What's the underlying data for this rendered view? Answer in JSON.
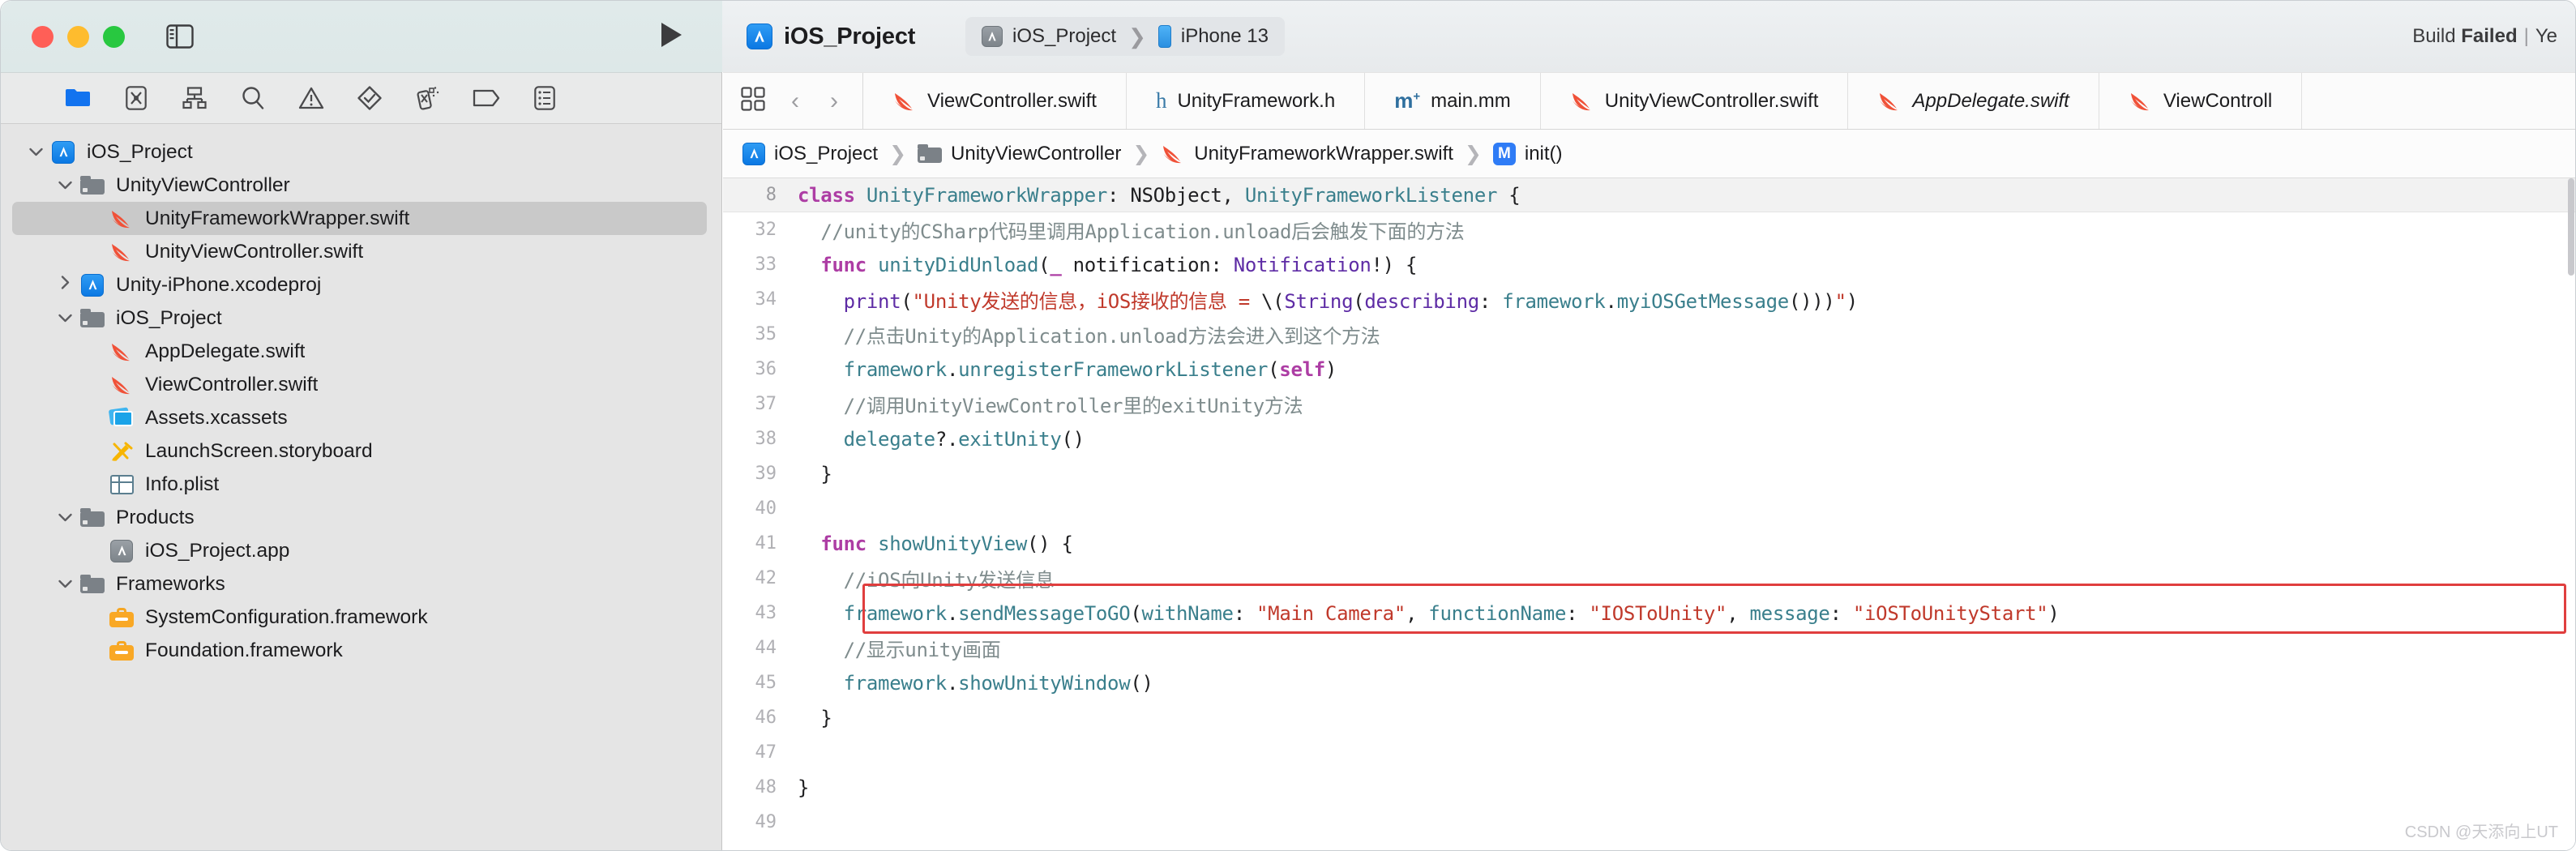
{
  "window": {
    "traffic_lights": [
      "close",
      "minimize",
      "zoom"
    ],
    "sidebar_toggle_icon": "sidebar-toggle-icon",
    "run_button_icon": "run-play-icon"
  },
  "toolbar": {
    "project_name": "iOS_Project",
    "scheme": "iOS_Project",
    "destination": "iPhone 13",
    "build_status_prefix": "Build ",
    "build_status_result": "Failed",
    "build_status_separator": "|",
    "build_status_suffix": "Ye",
    "accent_blue": "#0b78e3",
    "fail_color": "#3b3b3d"
  },
  "navigator": {
    "toolbar_icons": [
      {
        "name": "project-navigator-icon",
        "glyph": "folder",
        "active": true
      },
      {
        "name": "source-control-navigator-icon",
        "glyph": "x-box"
      },
      {
        "name": "symbol-navigator-icon",
        "glyph": "hierarchy"
      },
      {
        "name": "find-navigator-icon",
        "glyph": "magnifier"
      },
      {
        "name": "issue-navigator-icon",
        "glyph": "warning-triangle"
      },
      {
        "name": "test-navigator-icon",
        "glyph": "diamond-check"
      },
      {
        "name": "debug-navigator-icon",
        "glyph": "spray"
      },
      {
        "name": "breakpoint-navigator-icon",
        "glyph": "tag"
      },
      {
        "name": "report-navigator-icon",
        "glyph": "report-list"
      }
    ],
    "tree": [
      {
        "label": "iOS_Project",
        "icon": "app-icon",
        "depth": 0,
        "disclosure": "down",
        "selected": false
      },
      {
        "label": "UnityViewController",
        "icon": "folder-icon",
        "depth": 1,
        "disclosure": "down",
        "selected": false
      },
      {
        "label": "UnityFrameworkWrapper.swift",
        "icon": "swift-icon",
        "depth": 2,
        "disclosure": "none",
        "selected": true
      },
      {
        "label": "UnityViewController.swift",
        "icon": "swift-icon",
        "depth": 2,
        "disclosure": "none",
        "selected": false
      },
      {
        "label": "Unity-iPhone.xcodeproj",
        "icon": "app-icon",
        "depth": 1,
        "disclosure": "right",
        "selected": false
      },
      {
        "label": "iOS_Project",
        "icon": "folder-icon",
        "depth": 1,
        "disclosure": "down",
        "selected": false
      },
      {
        "label": "AppDelegate.swift",
        "icon": "swift-icon",
        "depth": 2,
        "disclosure": "none",
        "selected": false
      },
      {
        "label": "ViewController.swift",
        "icon": "swift-icon",
        "depth": 2,
        "disclosure": "none",
        "selected": false
      },
      {
        "label": "Assets.xcassets",
        "icon": "xcassets-icon",
        "depth": 2,
        "disclosure": "none",
        "selected": false
      },
      {
        "label": "LaunchScreen.storyboard",
        "icon": "storyboard-icon",
        "depth": 2,
        "disclosure": "none",
        "selected": false
      },
      {
        "label": "Info.plist",
        "icon": "plist-icon",
        "depth": 2,
        "disclosure": "none",
        "selected": false
      },
      {
        "label": "Products",
        "icon": "folder-icon",
        "depth": 1,
        "disclosure": "down",
        "selected": false
      },
      {
        "label": "iOS_Project.app",
        "icon": "app-gray-icon",
        "depth": 2,
        "disclosure": "none",
        "selected": false
      },
      {
        "label": "Frameworks",
        "icon": "folder-icon",
        "depth": 1,
        "disclosure": "down",
        "selected": false
      },
      {
        "label": "SystemConfiguration.framework",
        "icon": "framework-icon",
        "depth": 2,
        "disclosure": "none",
        "selected": false
      },
      {
        "label": "Foundation.framework",
        "icon": "framework-icon",
        "depth": 2,
        "disclosure": "none",
        "selected": false
      }
    ]
  },
  "editor": {
    "controls": {
      "layout_icon": "editor-layout-icon",
      "back_label": "‹",
      "forward_label": "›"
    },
    "tabs": [
      {
        "label": "ViewController.swift",
        "icon": "swift-icon",
        "italic": false
      },
      {
        "label": "UnityFramework.h",
        "icon": "header-icon",
        "italic": false
      },
      {
        "label": "main.mm",
        "icon": "objcpp-icon",
        "italic": false
      },
      {
        "label": "UnityViewController.swift",
        "icon": "swift-icon",
        "italic": false
      },
      {
        "label": "AppDelegate.swift",
        "icon": "swift-icon",
        "italic": true
      },
      {
        "label": "ViewControll",
        "icon": "swift-icon",
        "italic": false
      }
    ],
    "breadcrumb": [
      {
        "label": "iOS_Project",
        "icon": "app-icon"
      },
      {
        "label": "UnityViewController",
        "icon": "folder-icon"
      },
      {
        "label": "UnityFrameworkWrapper.swift",
        "icon": "swift-icon"
      },
      {
        "label": "init()",
        "icon": "method-badge-icon"
      }
    ],
    "separator": "❯",
    "code": {
      "sticky_line": {
        "number": "8",
        "tokens": [
          {
            "t": "class ",
            "c": "kw"
          },
          {
            "t": "UnityFrameworkWrapper",
            "c": "typ"
          },
          {
            "t": ": NSObject, ",
            "c": "pln"
          },
          {
            "t": "UnityFrameworkListener",
            "c": "typ"
          },
          {
            "t": " {",
            "c": "pln"
          }
        ]
      },
      "lines": [
        {
          "number": "32",
          "indent": 2,
          "tokens": [
            {
              "t": "//unity的CSharp代码里调用Application.unload后会触发下面的方法",
              "c": "cmt"
            }
          ]
        },
        {
          "number": "33",
          "indent": 2,
          "tokens": [
            {
              "t": "func ",
              "c": "kw"
            },
            {
              "t": "unityDidUnload",
              "c": "fn"
            },
            {
              "t": "(",
              "c": "pln"
            },
            {
              "t": "_",
              "c": "kw"
            },
            {
              "t": " notification: ",
              "c": "pln"
            },
            {
              "t": "Notification",
              "c": "tp2"
            },
            {
              "t": "!) {",
              "c": "pln"
            }
          ]
        },
        {
          "number": "34",
          "indent": 4,
          "tokens": [
            {
              "t": "print",
              "c": "tp2"
            },
            {
              "t": "(",
              "c": "pln"
            },
            {
              "t": "\"Unity发送的信息，iOS接收的信息 = ",
              "c": "str"
            },
            {
              "t": "\\(",
              "c": "pln"
            },
            {
              "t": "String",
              "c": "tp2"
            },
            {
              "t": "(",
              "c": "pln"
            },
            {
              "t": "describing",
              "c": "tp2"
            },
            {
              "t": ": ",
              "c": "pln"
            },
            {
              "t": "framework",
              "c": "fn"
            },
            {
              "t": ".",
              "c": "pln"
            },
            {
              "t": "myiOSGetMessage",
              "c": "fn"
            },
            {
              "t": "()))",
              "c": "pln"
            },
            {
              "t": "\"",
              "c": "str"
            },
            {
              "t": ")",
              "c": "pln"
            }
          ]
        },
        {
          "number": "35",
          "indent": 4,
          "tokens": [
            {
              "t": "//点击Unity的Application.unload方法会进入到这个方法",
              "c": "cmt"
            }
          ]
        },
        {
          "number": "36",
          "indent": 4,
          "tokens": [
            {
              "t": "framework",
              "c": "fn"
            },
            {
              "t": ".",
              "c": "pln"
            },
            {
              "t": "unregisterFrameworkListener",
              "c": "fn"
            },
            {
              "t": "(",
              "c": "pln"
            },
            {
              "t": "self",
              "c": "kw"
            },
            {
              "t": ")",
              "c": "pln"
            }
          ]
        },
        {
          "number": "37",
          "indent": 4,
          "tokens": [
            {
              "t": "//调用UnityViewController里的exitUnity方法",
              "c": "cmt"
            }
          ]
        },
        {
          "number": "38",
          "indent": 4,
          "tokens": [
            {
              "t": "delegate",
              "c": "fn"
            },
            {
              "t": "?.",
              "c": "pln"
            },
            {
              "t": "exitUnity",
              "c": "fn"
            },
            {
              "t": "()",
              "c": "pln"
            }
          ]
        },
        {
          "number": "39",
          "indent": 2,
          "tokens": [
            {
              "t": "}",
              "c": "pln"
            }
          ]
        },
        {
          "number": "40",
          "indent": 0,
          "tokens": []
        },
        {
          "number": "41",
          "indent": 2,
          "tokens": [
            {
              "t": "func ",
              "c": "kw"
            },
            {
              "t": "showUnityView",
              "c": "fn"
            },
            {
              "t": "() {",
              "c": "pln"
            }
          ]
        },
        {
          "number": "42",
          "indent": 4,
          "tokens": [
            {
              "t": "//iOS向Unity发送信息",
              "c": "cmt"
            }
          ]
        },
        {
          "number": "43",
          "indent": 4,
          "tokens": [
            {
              "t": "framework",
              "c": "fn"
            },
            {
              "t": ".",
              "c": "pln"
            },
            {
              "t": "sendMessageToGO",
              "c": "fn"
            },
            {
              "t": "(",
              "c": "pln"
            },
            {
              "t": "withName",
              "c": "fn"
            },
            {
              "t": ": ",
              "c": "pln"
            },
            {
              "t": "\"Main Camera\"",
              "c": "str"
            },
            {
              "t": ", ",
              "c": "pln"
            },
            {
              "t": "functionName",
              "c": "fn"
            },
            {
              "t": ": ",
              "c": "pln"
            },
            {
              "t": "\"IOSToUnity\"",
              "c": "str"
            },
            {
              "t": ", ",
              "c": "pln"
            },
            {
              "t": "message",
              "c": "fn"
            },
            {
              "t": ": ",
              "c": "pln"
            },
            {
              "t": "\"iOSToUnityStart\"",
              "c": "str"
            },
            {
              "t": ")",
              "c": "pln"
            }
          ]
        },
        {
          "number": "44",
          "indent": 4,
          "tokens": [
            {
              "t": "//显示unity画面",
              "c": "cmt"
            }
          ]
        },
        {
          "number": "45",
          "indent": 4,
          "tokens": [
            {
              "t": "framework",
              "c": "fn"
            },
            {
              "t": ".",
              "c": "pln"
            },
            {
              "t": "showUnityWindow",
              "c": "fn"
            },
            {
              "t": "()",
              "c": "pln"
            }
          ]
        },
        {
          "number": "46",
          "indent": 2,
          "tokens": [
            {
              "t": "}",
              "c": "pln"
            }
          ]
        },
        {
          "number": "47",
          "indent": 0,
          "tokens": []
        },
        {
          "number": "48",
          "indent": 0,
          "tokens": [
            {
              "t": "}",
              "c": "pln"
            }
          ]
        },
        {
          "number": "49",
          "indent": 0,
          "tokens": []
        }
      ],
      "highlight_box": {
        "color": "#e03e3e",
        "start_line": "43"
      }
    }
  },
  "watermark": "CSDN @天添向上UT"
}
